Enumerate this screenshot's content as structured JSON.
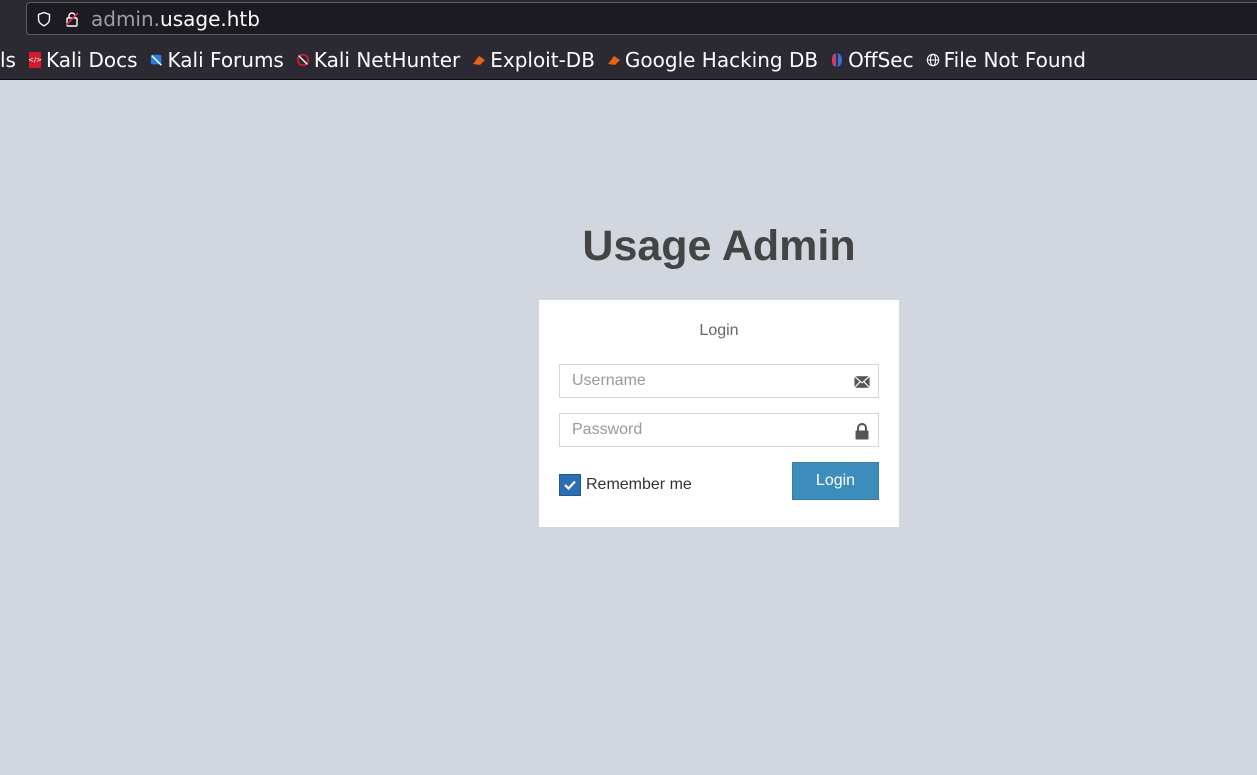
{
  "browser": {
    "url_subdomain": "admin.",
    "url_domain": "usage.htb",
    "bookmarks": [
      {
        "label": "ls",
        "icon": "none"
      },
      {
        "label": "Kali Docs",
        "icon": "kali-docs-icon"
      },
      {
        "label": "Kali Forums",
        "icon": "kali-forums-icon"
      },
      {
        "label": "Kali NetHunter",
        "icon": "nethunter-icon"
      },
      {
        "label": "Exploit-DB",
        "icon": "exploit-db-icon"
      },
      {
        "label": "Google Hacking DB",
        "icon": "ghdb-icon"
      },
      {
        "label": "OffSec",
        "icon": "offsec-icon"
      },
      {
        "label": "File Not Found",
        "icon": "globe-icon"
      }
    ]
  },
  "page": {
    "title": "Usage Admin",
    "box_message": "Login",
    "username_placeholder": "Username",
    "password_placeholder": "Password",
    "remember_label": "Remember me",
    "remember_checked": true,
    "login_button": "Login"
  },
  "colors": {
    "background": "#d2d6de",
    "primary_button": "#3c8dbc",
    "checkbox": "#2a6fb3"
  }
}
